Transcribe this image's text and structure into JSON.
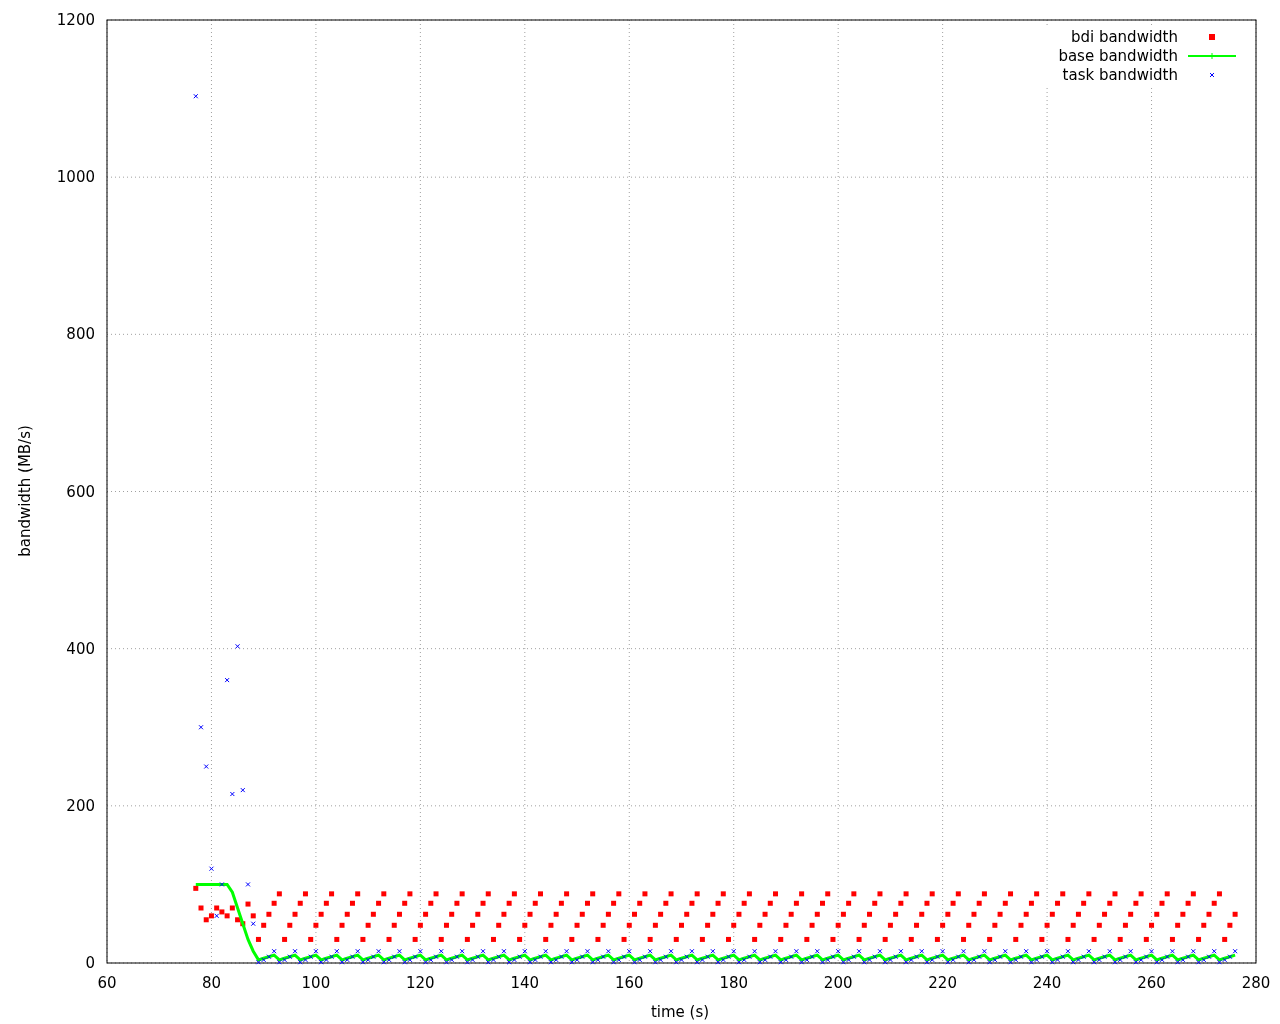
{
  "chart_data": {
    "type": "scatter",
    "xlabel": "time (s)",
    "ylabel": "bandwidth (MB/s)",
    "xlim": [
      60,
      280
    ],
    "ylim": [
      0,
      1200
    ],
    "xticks": [
      60,
      80,
      100,
      120,
      140,
      160,
      180,
      200,
      220,
      240,
      260,
      280
    ],
    "yticks": [
      0,
      200,
      400,
      600,
      800,
      1000,
      1200
    ],
    "grid": true,
    "legend": true,
    "x": [
      77,
      78,
      79,
      80,
      81,
      82,
      83,
      84,
      85,
      86,
      87,
      88,
      89,
      90,
      91,
      92,
      93,
      94,
      95,
      96,
      97,
      98,
      99,
      100,
      101,
      102,
      103,
      104,
      105,
      106,
      107,
      108,
      109,
      110,
      111,
      112,
      113,
      114,
      115,
      116,
      117,
      118,
      119,
      120,
      121,
      122,
      123,
      124,
      125,
      126,
      127,
      128,
      129,
      130,
      131,
      132,
      133,
      134,
      135,
      136,
      137,
      138,
      139,
      140,
      141,
      142,
      143,
      144,
      145,
      146,
      147,
      148,
      149,
      150,
      151,
      152,
      153,
      154,
      155,
      156,
      157,
      158,
      159,
      160,
      161,
      162,
      163,
      164,
      165,
      166,
      167,
      168,
      169,
      170,
      171,
      172,
      173,
      174,
      175,
      176,
      177,
      178,
      179,
      180,
      181,
      182,
      183,
      184,
      185,
      186,
      187,
      188,
      189,
      190,
      191,
      192,
      193,
      194,
      195,
      196,
      197,
      198,
      199,
      200,
      201,
      202,
      203,
      204,
      205,
      206,
      207,
      208,
      209,
      210,
      211,
      212,
      213,
      214,
      215,
      216,
      217,
      218,
      219,
      220,
      221,
      222,
      223,
      224,
      225,
      226,
      227,
      228,
      229,
      230,
      231,
      232,
      233,
      234,
      235,
      236,
      237,
      238,
      239,
      240,
      241,
      242,
      243,
      244,
      245,
      246,
      247,
      248,
      249,
      250,
      251,
      252,
      253,
      254,
      255,
      256,
      257,
      258,
      259,
      260,
      261,
      262,
      263,
      264,
      265,
      266,
      267,
      268,
      269,
      270,
      271,
      272,
      273,
      274,
      275,
      276
    ],
    "series": [
      {
        "name": "bdi bandwidth",
        "type": "scatter",
        "marker": "square",
        "color": "#ff0000",
        "values": [
          95,
          70,
          55,
          60,
          70,
          65,
          60,
          70,
          55,
          50,
          75,
          60,
          30,
          48,
          62,
          76,
          88,
          30,
          48,
          62,
          76,
          88,
          30,
          48,
          62,
          76,
          88,
          30,
          48,
          62,
          76,
          88,
          30,
          48,
          62,
          76,
          88,
          30,
          48,
          62,
          76,
          88,
          30,
          48,
          62,
          76,
          88,
          30,
          48,
          62,
          76,
          88,
          30,
          48,
          62,
          76,
          88,
          30,
          48,
          62,
          76,
          88,
          30,
          48,
          62,
          76,
          88,
          30,
          48,
          62,
          76,
          88,
          30,
          48,
          62,
          76,
          88,
          30,
          48,
          62,
          76,
          88,
          30,
          48,
          62,
          76,
          88,
          30,
          48,
          62,
          76,
          88,
          30,
          48,
          62,
          76,
          88,
          30,
          48,
          62,
          76,
          88,
          30,
          48,
          62,
          76,
          88,
          30,
          48,
          62,
          76,
          88,
          30,
          48,
          62,
          76,
          88,
          30,
          48,
          62,
          76,
          88,
          30,
          48,
          62,
          76,
          88,
          30,
          48,
          62,
          76,
          88,
          30,
          48,
          62,
          76,
          88,
          30,
          48,
          62,
          76,
          88,
          30,
          48,
          62,
          76,
          88,
          30,
          48,
          62,
          76,
          88,
          30,
          48,
          62,
          76,
          88,
          30,
          48,
          62,
          76,
          88,
          30,
          48,
          62,
          76,
          88,
          30,
          48,
          62,
          76,
          88,
          30,
          48,
          62,
          76,
          88,
          30,
          48,
          62,
          76,
          88,
          30,
          48,
          62,
          76,
          88,
          30,
          48,
          62,
          76,
          88,
          30,
          48,
          62,
          76,
          88,
          30,
          48,
          62
        ]
      },
      {
        "name": "base bandwidth",
        "type": "line",
        "color": "#00ff00",
        "values": [
          100,
          100,
          100,
          100,
          100,
          100,
          100,
          90,
          70,
          50,
          30,
          15,
          4,
          6,
          8,
          10,
          4,
          6,
          8,
          10,
          4,
          6,
          8,
          10,
          4,
          6,
          8,
          10,
          4,
          6,
          8,
          10,
          4,
          6,
          8,
          10,
          4,
          6,
          8,
          10,
          4,
          6,
          8,
          10,
          4,
          6,
          8,
          10,
          4,
          6,
          8,
          10,
          4,
          6,
          8,
          10,
          4,
          6,
          8,
          10,
          4,
          6,
          8,
          10,
          4,
          6,
          8,
          10,
          4,
          6,
          8,
          10,
          4,
          6,
          8,
          10,
          4,
          6,
          8,
          10,
          4,
          6,
          8,
          10,
          4,
          6,
          8,
          10,
          4,
          6,
          8,
          10,
          4,
          6,
          8,
          10,
          4,
          6,
          8,
          10,
          4,
          6,
          8,
          10,
          4,
          6,
          8,
          10,
          4,
          6,
          8,
          10,
          4,
          6,
          8,
          10,
          4,
          6,
          8,
          10,
          4,
          6,
          8,
          10,
          4,
          6,
          8,
          10,
          4,
          6,
          8,
          10,
          4,
          6,
          8,
          10,
          4,
          6,
          8,
          10,
          4,
          6,
          8,
          10,
          4,
          6,
          8,
          10,
          4,
          6,
          8,
          10,
          4,
          6,
          8,
          10,
          4,
          6,
          8,
          10,
          4,
          6,
          8,
          10,
          4,
          6,
          8,
          10,
          4,
          6,
          8,
          10,
          4,
          6,
          8,
          10,
          4,
          6,
          8,
          10,
          4,
          6,
          8,
          10,
          4,
          6,
          8,
          10,
          4,
          6,
          8,
          10,
          4,
          6,
          8,
          10,
          4,
          6,
          8,
          10
        ]
      },
      {
        "name": "task bandwidth",
        "type": "scatter",
        "marker": "cross",
        "color": "#0000ff",
        "values": [
          1103,
          300,
          250,
          120,
          60,
          100,
          360,
          215,
          403,
          220,
          100,
          50,
          1,
          4,
          8,
          15,
          1,
          4,
          8,
          15,
          1,
          4,
          8,
          15,
          1,
          4,
          8,
          15,
          1,
          4,
          8,
          15,
          1,
          4,
          8,
          15,
          1,
          4,
          8,
          15,
          1,
          4,
          8,
          15,
          1,
          4,
          8,
          15,
          1,
          4,
          8,
          15,
          1,
          4,
          8,
          15,
          1,
          4,
          8,
          15,
          1,
          4,
          8,
          15,
          1,
          4,
          8,
          15,
          1,
          4,
          8,
          15,
          1,
          4,
          8,
          15,
          1,
          4,
          8,
          15,
          1,
          4,
          8,
          15,
          1,
          4,
          8,
          15,
          1,
          4,
          8,
          15,
          1,
          4,
          8,
          15,
          1,
          4,
          8,
          15,
          1,
          4,
          8,
          15,
          1,
          4,
          8,
          15,
          1,
          4,
          8,
          15,
          1,
          4,
          8,
          15,
          1,
          4,
          8,
          15,
          1,
          4,
          8,
          15,
          1,
          4,
          8,
          15,
          1,
          4,
          8,
          15,
          1,
          4,
          8,
          15,
          1,
          4,
          8,
          15,
          1,
          4,
          8,
          15,
          1,
          4,
          8,
          15,
          1,
          4,
          8,
          15,
          1,
          4,
          8,
          15,
          1,
          4,
          8,
          15,
          1,
          4,
          8,
          15,
          1,
          4,
          8,
          15,
          1,
          4,
          8,
          15,
          1,
          4,
          8,
          15,
          1,
          4,
          8,
          15,
          1,
          4,
          8,
          15,
          1,
          4,
          8,
          15,
          1,
          4,
          8,
          15,
          1,
          4,
          8,
          15,
          1,
          4,
          8,
          15
        ]
      }
    ]
  }
}
